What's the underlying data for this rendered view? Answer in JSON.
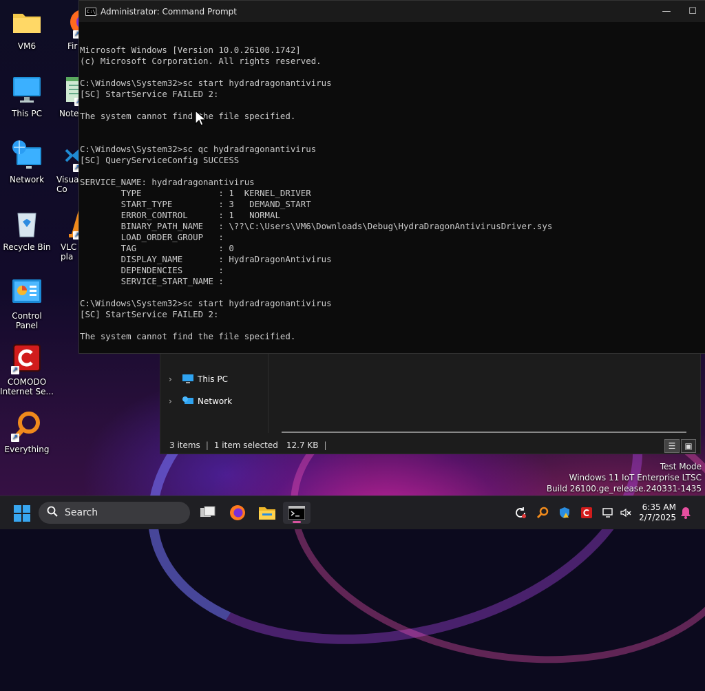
{
  "desktop": {
    "icons": [
      {
        "label": "VM6"
      },
      {
        "label": "This PC"
      },
      {
        "label": "Network"
      },
      {
        "label": "Recycle Bin"
      },
      {
        "label": "Control Panel"
      },
      {
        "label": "COMODO Internet Se..."
      },
      {
        "label": "Everything"
      }
    ],
    "partial_icons": [
      {
        "label": "Fir"
      },
      {
        "label": "Note"
      },
      {
        "label": "Visual Co"
      },
      {
        "label": "VLC pla"
      }
    ]
  },
  "cmd": {
    "title": "Administrator: Command Prompt",
    "icon_text": "C:\\_",
    "minimize_glyph": "—",
    "maximize_glyph": "☐",
    "lines": [
      "Microsoft Windows [Version 10.0.26100.1742]",
      "(c) Microsoft Corporation. All rights reserved.",
      "",
      "C:\\Windows\\System32>sc start hydradragonantivirus",
      "[SC] StartService FAILED 2:",
      "",
      "The system cannot find the file specified.",
      "",
      "",
      "C:\\Windows\\System32>sc qc hydradragonantivirus",
      "[SC] QueryServiceConfig SUCCESS",
      "",
      "SERVICE_NAME: hydradragonantivirus",
      "        TYPE               : 1  KERNEL_DRIVER",
      "        START_TYPE         : 3   DEMAND_START",
      "        ERROR_CONTROL      : 1   NORMAL",
      "        BINARY_PATH_NAME   : \\??\\C:\\Users\\VM6\\Downloads\\Debug\\HydraDragonAntivirusDriver.sys",
      "        LOAD_ORDER_GROUP   :",
      "        TAG                : 0",
      "        DISPLAY_NAME       : HydraDragonAntivirus",
      "        DEPENDENCIES       :",
      "        SERVICE_START_NAME :",
      "",
      "C:\\Windows\\System32>sc start hydradragonantivirus",
      "[SC] StartService FAILED 2:",
      "",
      "The system cannot find the file specified.",
      "",
      ""
    ],
    "prompt": "C:\\Windows\\System32>"
  },
  "explorer": {
    "nav": [
      {
        "label": "This PC"
      },
      {
        "label": "Network"
      }
    ],
    "status": {
      "items": "3 items",
      "selected": "1 item selected",
      "size": "12.7 KB"
    }
  },
  "watermark": {
    "line1": "Test Mode",
    "line2": "Windows 11 IoT Enterprise LTSC",
    "line3": "Build 26100.ge_release.240331-1435"
  },
  "taskbar": {
    "search_label": "Search",
    "clock_time": "6:35 AM",
    "clock_date": "2/7/2025"
  },
  "colors": {
    "console_bg": "#0c0c0c",
    "console_fg": "#cccccc",
    "taskbar_bg": "#1f1f23",
    "active_app_underline": "#d9529e"
  }
}
